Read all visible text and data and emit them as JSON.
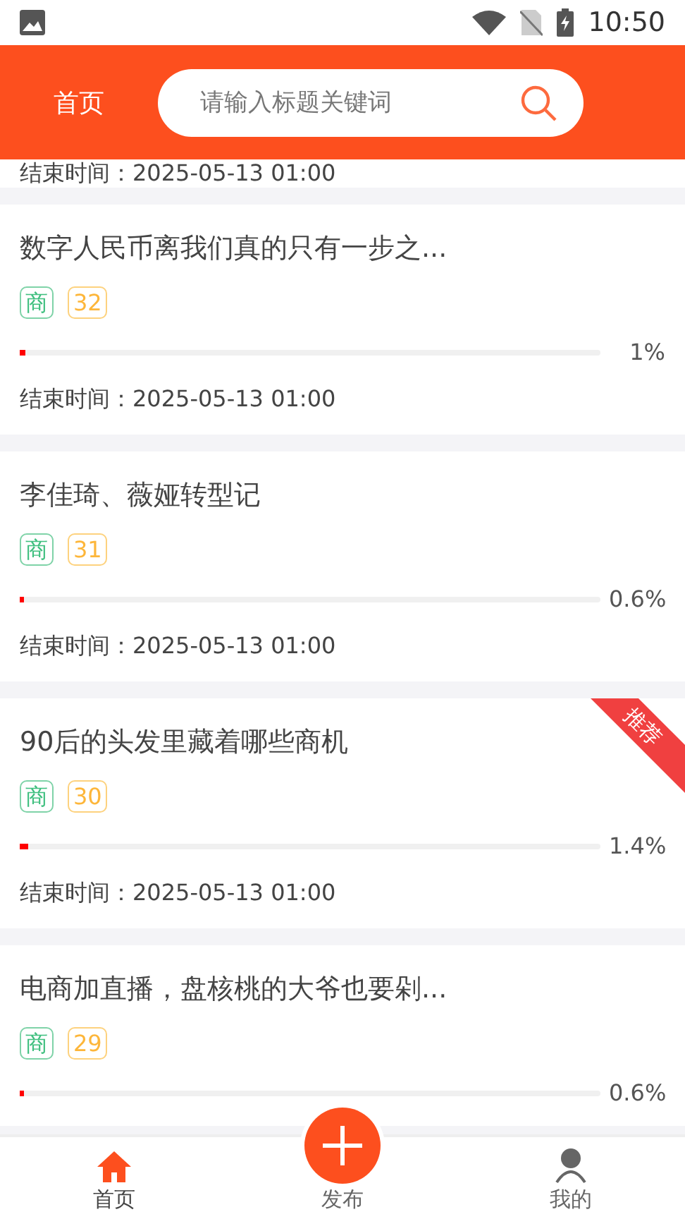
{
  "status_bar": {
    "time": "10:50"
  },
  "header": {
    "title": "首页",
    "search": {
      "placeholder": "请输入标题关键词"
    }
  },
  "partial_end_time": "结束时间：2025-05-13 01:00",
  "items": [
    {
      "title": "数字人民币离我们真的只有一步之...",
      "category": "商",
      "count": "32",
      "level": 0.01,
      "percent": "1%",
      "end_time": "结束时间：2025-05-13 01:00"
    },
    {
      "title": "李佳琦、薇娅转型记",
      "category": "商",
      "count": "31",
      "level": 0.006,
      "percent": "0.6%",
      "end_time": "结束时间：2025-05-13 01:00"
    },
    {
      "title": "90后的头发里藏着哪些商机",
      "category": "商",
      "count": "30",
      "level": 0.014,
      "percent": "1.4%",
      "end_time": "结束时间：2025-05-13 01:00",
      "ribbon": "推荐"
    },
    {
      "title": "电商加直播，盘核桃的大爷也要剁...",
      "category": "商",
      "count": "29",
      "level": 0.006,
      "percent": "0.6%"
    }
  ],
  "nav": {
    "tabs": [
      {
        "kind": "home",
        "label": "首页",
        "selected": true
      },
      {
        "kind": "publish",
        "label": "发布",
        "selected": false
      },
      {
        "kind": "profile",
        "label": "我的",
        "selected": false
      }
    ]
  }
}
